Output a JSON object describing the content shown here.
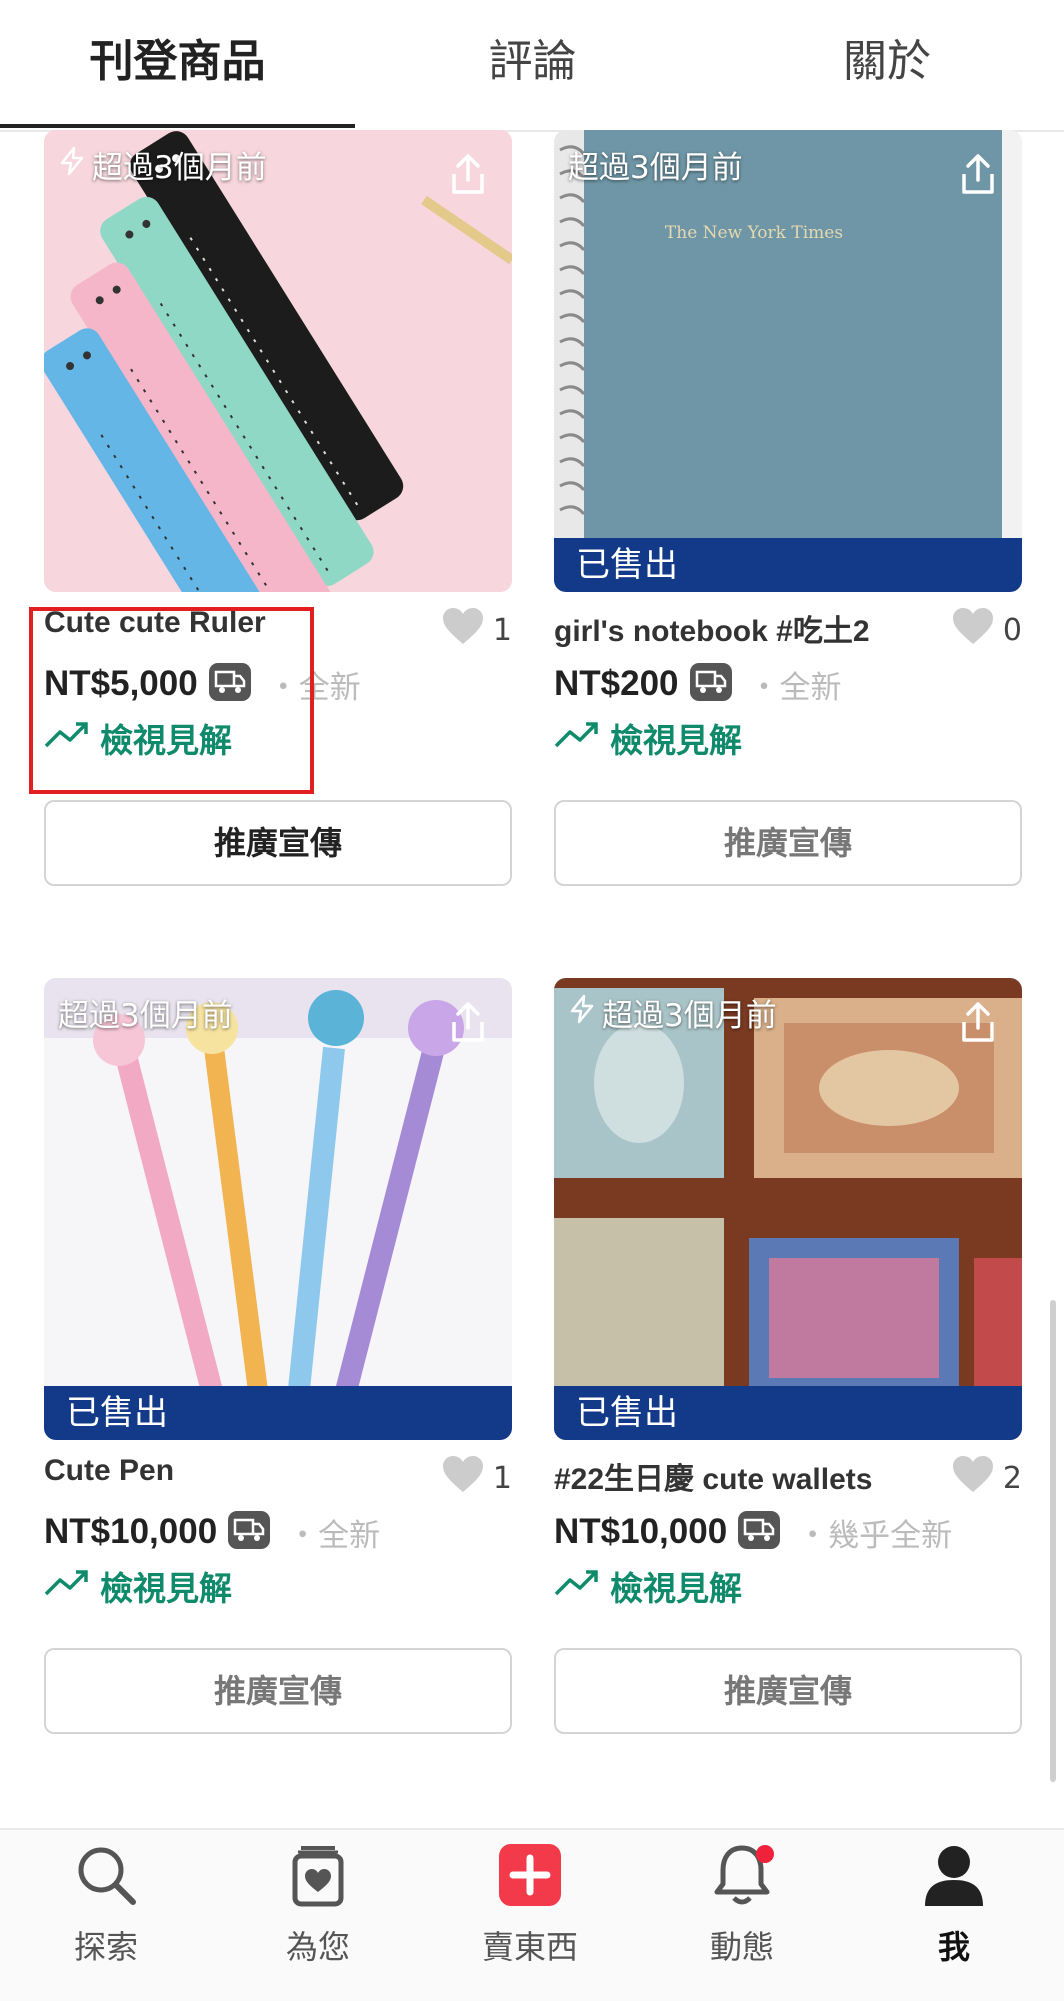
{
  "tabs": [
    "刊登商品",
    "評論",
    "關於"
  ],
  "colors": {
    "accent_green": "#0f8a6b",
    "sold_banner": "#123a88",
    "highlight": "#e21e1e",
    "sell_button": "#f23a4a"
  },
  "products": [
    {
      "timestamp": "超過3個月前",
      "title": "Cute cute Ruler",
      "likes": "1",
      "price": "NT$5,000",
      "condition": "・全新",
      "insight": "檢視見解",
      "promote": "推廣宣傳",
      "sold": ""
    },
    {
      "timestamp": "超過3個月前",
      "title": "girl's notebook #吃土2",
      "likes": "0",
      "price": "NT$200",
      "condition": "・全新",
      "insight": "檢視見解",
      "promote": "推廣宣傳",
      "sold": "已售出",
      "cover_text": "The New York Times"
    },
    {
      "timestamp": "超過3個月前",
      "title": "Cute Pen",
      "likes": "1",
      "price": "NT$10,000",
      "condition": "・全新",
      "insight": "檢視見解",
      "promote": "推廣宣傳",
      "sold": "已售出"
    },
    {
      "timestamp": "超過3個月前",
      "title": "#22生日慶 cute wallets",
      "likes": "2",
      "price": "NT$10,000",
      "condition": "・幾乎全新",
      "insight": "檢視見解",
      "promote": "推廣宣傳",
      "sold": "已售出"
    }
  ],
  "bottom_nav": [
    {
      "label": "探索",
      "icon": "search-icon"
    },
    {
      "label": "為您",
      "icon": "for-you-icon"
    },
    {
      "label": "賣東西",
      "icon": "sell-plus-icon"
    },
    {
      "label": "動態",
      "icon": "bell-icon"
    },
    {
      "label": "我",
      "icon": "profile-icon"
    }
  ]
}
